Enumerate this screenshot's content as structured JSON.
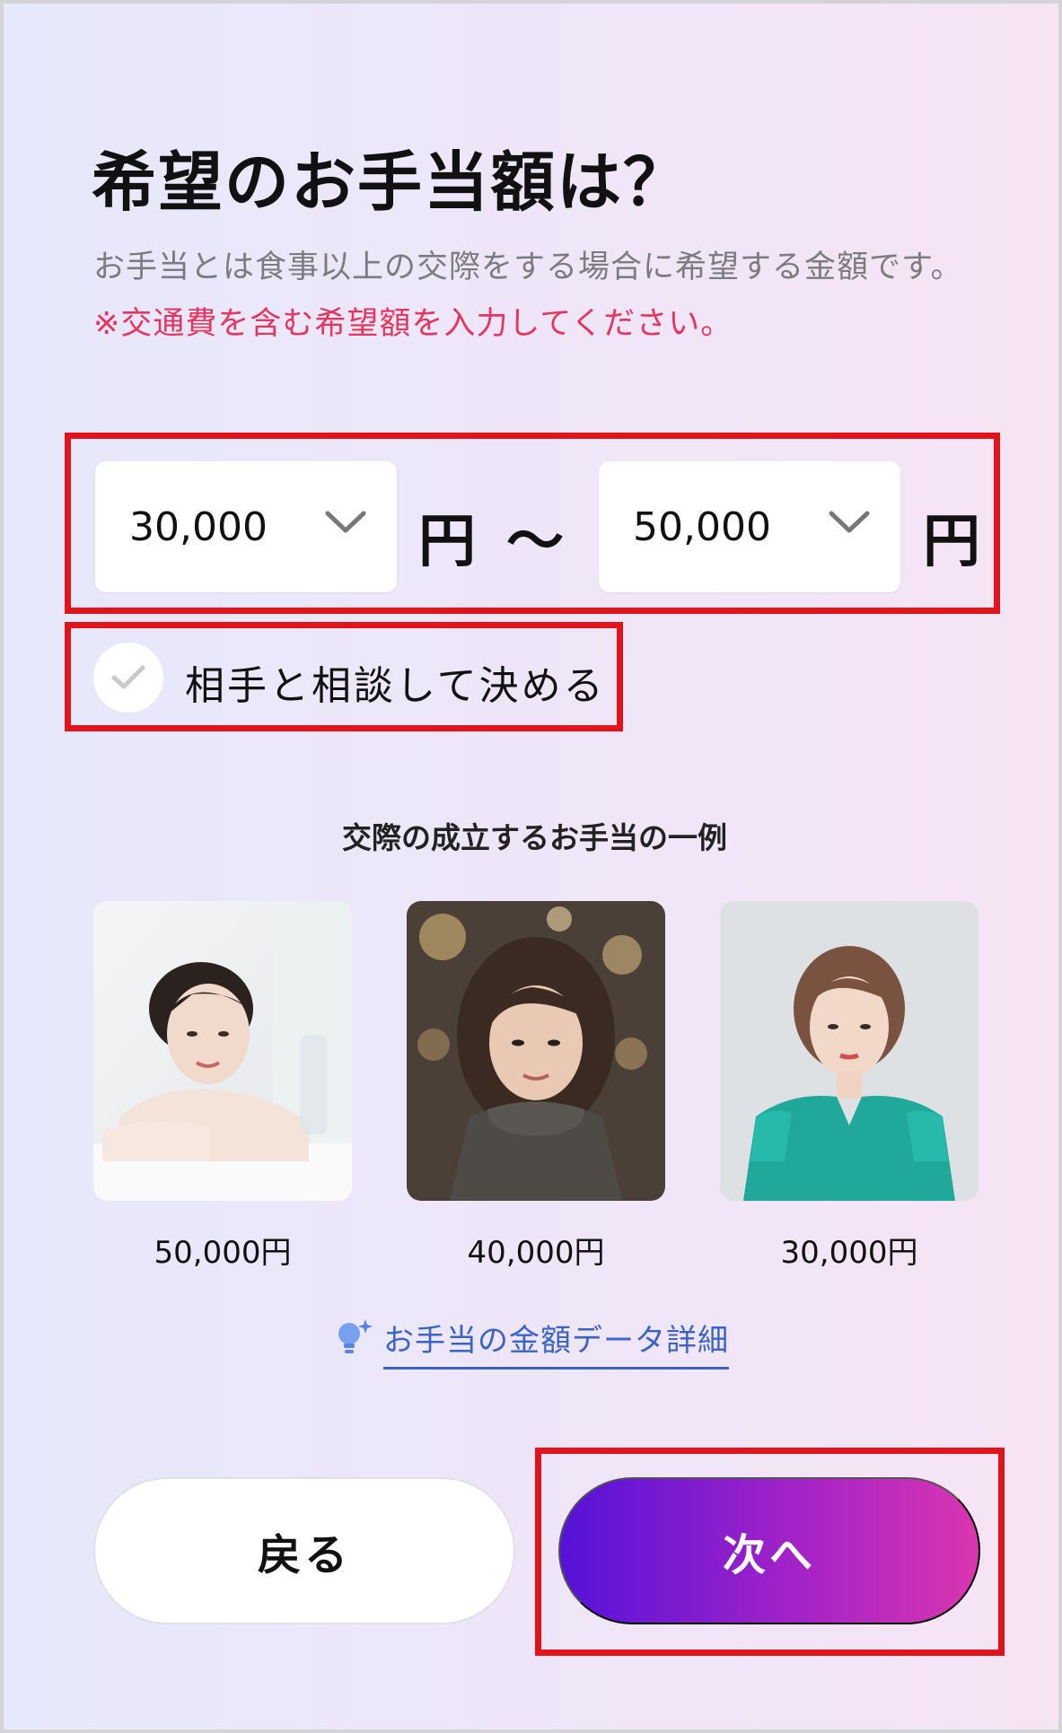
{
  "header": {
    "title": "希望のお手当額は？",
    "subtitle": "お手当とは食事以上の交際をする場合に希望する金額です。",
    "notice": "※交通費を含む希望額を入力してください。"
  },
  "range": {
    "min_value": "30,000",
    "max_value": "50,000",
    "unit": "円",
    "separator": "〜"
  },
  "negotiate": {
    "label": "相手と相談して決める",
    "checked": false
  },
  "examples": {
    "title": "交際の成立するお手当の一例",
    "items": [
      {
        "price": "50,000円"
      },
      {
        "price": "40,000円"
      },
      {
        "price": "30,000円"
      }
    ]
  },
  "detail_link": {
    "label": "お手当の金額データ詳細"
  },
  "buttons": {
    "back": "戻る",
    "next": "次へ"
  },
  "colors": {
    "accent_start": "#5512d8",
    "accent_end": "#da36b0",
    "notice": "#e6365d",
    "link": "#3a64c8",
    "highlight": "#e1141c"
  }
}
